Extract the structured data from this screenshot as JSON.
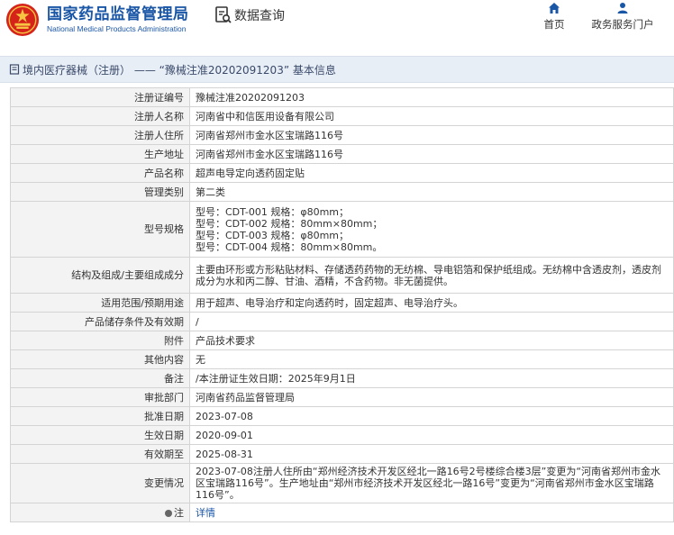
{
  "header": {
    "logo_cn": "国家药品监督管理局",
    "logo_en": "National Medical Products Administration",
    "query_label": "数据查询",
    "nav": [
      {
        "label": "首页",
        "icon": "home-icon"
      },
      {
        "label": "政务服务门户",
        "icon": "user-icon"
      }
    ]
  },
  "title_bar": {
    "text": "境内医疗器械（注册） —— “豫械注准20202091203” 基本信息"
  },
  "colors": {
    "brand": "#1a56a6",
    "emblem_red": "#d6231a",
    "label_bg": "#f3f3f3"
  },
  "rows": [
    {
      "label": "注册证编号",
      "value": "豫械注准20202091203"
    },
    {
      "label": "注册人名称",
      "value": "河南省中和信医用设备有限公司"
    },
    {
      "label": "注册人住所",
      "value": "河南省郑州市金水区宝瑞路116号"
    },
    {
      "label": "生产地址",
      "value": "河南省郑州市金水区宝瑞路116号"
    },
    {
      "label": "产品名称",
      "value": "超声电导定向透药固定贴"
    },
    {
      "label": "管理类别",
      "value": "第二类"
    },
    {
      "label": "型号规格",
      "lines": [
        "型号：CDT-001 规格：φ80mm；",
        "型号：CDT-002 规格：80mm×80mm；",
        "型号：CDT-003 规格：φ80mm；",
        "型号：CDT-004 规格：80mm×80mm。"
      ]
    },
    {
      "label": "结构及组成/主要组成成分",
      "value": "主要由环形或方形粘贴材料、存储透药药物的无纺棉、导电铝箔和保护纸组成。无纺棉中含透皮剂，透皮剂成分为水和丙二醇、甘油、酒精，不含药物。非无菌提供。"
    },
    {
      "label": "适用范围/预期用途",
      "value": "用于超声、电导治疗和定向透药时，固定超声、电导治疗头。"
    },
    {
      "label": "产品储存条件及有效期",
      "value": "/"
    },
    {
      "label": "附件",
      "value": "产品技术要求"
    },
    {
      "label": "其他内容",
      "value": "无"
    },
    {
      "label": "备注",
      "value": "/本注册证生效日期：2025年9月1日"
    },
    {
      "label": "审批部门",
      "value": "河南省药品监督管理局"
    },
    {
      "label": "批准日期",
      "value": "2023-07-08"
    },
    {
      "label": "生效日期",
      "value": "2020-09-01"
    },
    {
      "label": "有效期至",
      "value": "2025-08-31"
    },
    {
      "label": "变更情况",
      "value": "2023-07-08注册人住所由“郑州经济技术开发区经北一路16号2号楼综合楼3层”变更为“河南省郑州市金水区宝瑞路116号”。生产地址由“郑州市经济技术开发区经北一路16号”变更为“河南省郑州市金水区宝瑞路116号”。"
    },
    {
      "label": "注",
      "value": "详情"
    }
  ]
}
